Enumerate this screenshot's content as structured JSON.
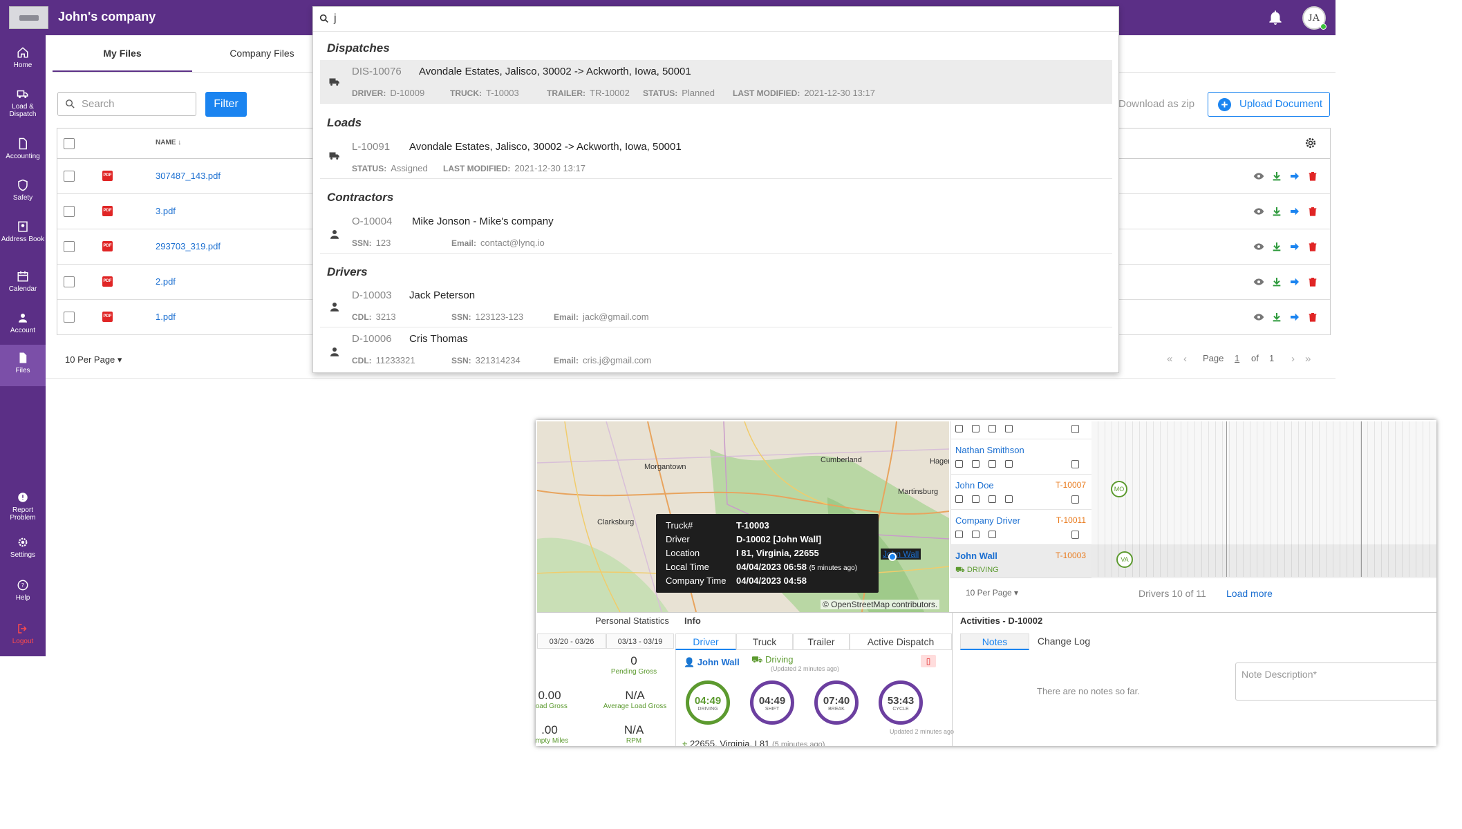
{
  "header": {
    "company": "John's company",
    "avatar_initials": "JA"
  },
  "sidebar": {
    "items": [
      {
        "label": "Home",
        "icon": "home-icon"
      },
      {
        "label": "Load & Dispatch",
        "icon": "truck-icon"
      },
      {
        "label": "Accounting",
        "icon": "document-icon"
      },
      {
        "label": "Safety",
        "icon": "shield-icon"
      },
      {
        "label": "Address Book",
        "icon": "address-book-icon"
      },
      {
        "label": "Calendar",
        "icon": "calendar-icon"
      },
      {
        "label": "Account",
        "icon": "user-icon"
      },
      {
        "label": "Files",
        "icon": "file-icon",
        "active": true
      },
      {
        "label": "Report Problem",
        "icon": "alert-icon"
      },
      {
        "label": "Settings",
        "icon": "gear-icon"
      },
      {
        "label": "Help",
        "icon": "help-icon"
      },
      {
        "label": "Logout",
        "icon": "logout-icon"
      }
    ]
  },
  "tabs": {
    "my_files": "My Files",
    "company_files": "Company Files"
  },
  "toolbar": {
    "search_placeholder": "Search",
    "filter_label": "Filter",
    "zip_label": "Download as zip",
    "upload_label": "Upload Document"
  },
  "table": {
    "name_header": "NAME",
    "sort_glyph": "↓",
    "rows": [
      {
        "name": "307487_143.pdf"
      },
      {
        "name": "3.pdf"
      },
      {
        "name": "293703_319.pdf"
      },
      {
        "name": "2.pdf"
      },
      {
        "name": "1.pdf"
      }
    ],
    "per_page": "10 Per Page",
    "pager": {
      "page_label": "Page",
      "current": "1",
      "of_label": "of",
      "total": "1"
    }
  },
  "search_dropdown": {
    "query": "j",
    "sections": {
      "dispatches": "Dispatches",
      "loads": "Loads",
      "contractors": "Contractors",
      "drivers": "Drivers"
    },
    "dispatch": {
      "id": "DIS-10076",
      "route": "Avondale Estates, Jalisco, 30002 -> Ackworth, Iowa, 50001",
      "driver_label": "DRIVER:",
      "driver": "D-10009",
      "truck_label": "TRUCK:",
      "truck": "T-10003",
      "trailer_label": "TRAILER:",
      "trailer": "TR-10002",
      "status_label": "STATUS:",
      "status": "Planned",
      "modified_label": "LAST MODIFIED:",
      "modified": "2021-12-30 13:17"
    },
    "load": {
      "id": "L-10091",
      "route": "Avondale Estates, Jalisco, 30002 -> Ackworth, Iowa, 50001",
      "status_label": "STATUS:",
      "status": "Assigned",
      "modified_label": "LAST MODIFIED:",
      "modified": "2021-12-30 13:17"
    },
    "contractor": {
      "id": "O-10004",
      "name": "Mike Jonson - Mike's company",
      "ssn_label": "SSN:",
      "ssn": "123",
      "email_label": "Email:",
      "email": "contact@lynq.io"
    },
    "drivers": [
      {
        "id": "D-10003",
        "name": "Jack Peterson",
        "cdl_label": "CDL:",
        "cdl": "3213",
        "ssn_label": "SSN:",
        "ssn": "123123-123",
        "email_label": "Email:",
        "email": "jack@gmail.com"
      },
      {
        "id": "D-10006",
        "name": "Cris Thomas",
        "cdl_label": "CDL:",
        "cdl": "11233321",
        "ssn_label": "SSN:",
        "ssn": "321314234",
        "email_label": "Email:",
        "email": "cris.j@gmail.com"
      }
    ]
  },
  "embed": {
    "map_labels": {
      "morgantown": "Morgantown",
      "cumberland": "Cumberland",
      "hager": "Hager",
      "martinsburg": "Martinsburg",
      "clarksburg": "Clarksburg"
    },
    "tooltip": {
      "truck_k": "Truck#",
      "truck_v": "T-10003",
      "driver_k": "Driver",
      "driver_v": "D-10002 [John Wall]",
      "location_k": "Location",
      "location_v": "I 81, Virginia, 22655",
      "local_k": "Local Time",
      "local_v": "04/04/2023 06:58",
      "local_note": "(5 minutes ago)",
      "company_k": "Company Time",
      "company_v": "04/04/2023 04:58"
    },
    "marker_label": "John Wall",
    "osm": "© OpenStreetMap contributors.",
    "drivers": [
      {
        "name": "",
        "truck": ""
      },
      {
        "name": "Nathan Smithson",
        "truck": ""
      },
      {
        "name": "John Doe",
        "truck": "T-10007"
      },
      {
        "name": "Company Driver",
        "truck": "T-10011"
      },
      {
        "name": "John Wall",
        "truck": "T-10003",
        "status": "DRIVING"
      }
    ],
    "timeline_marks": [
      "MO",
      "VA"
    ],
    "drivers_footer": {
      "per_page": "10 Per Page",
      "count": "Drivers 10 of 11",
      "load_more": "Load more"
    },
    "personal_stats_label": "Personal Statistics",
    "info_label": "Info",
    "weeks": [
      "03/20 - 03/26",
      "03/13 - 03/19"
    ],
    "stats": [
      {
        "val": "0",
        "lbl": "Pending Gross"
      },
      {
        "val": "0.00",
        "lbl": "Load Gross"
      },
      {
        "val": "N/A",
        "lbl": "Average Load Gross"
      },
      {
        "val": ".00",
        "lbl": "Empty Miles"
      },
      {
        "val": "N/A",
        "lbl": "RPM"
      }
    ],
    "info_tabs": [
      "Driver",
      "Truck",
      "Trailer",
      "Active Dispatch"
    ],
    "driver_name": "John Wall",
    "driving_status": "Driving",
    "driving_updated": "(Updated 2 minutes ago)",
    "rings": [
      {
        "time": "04:49",
        "label": "DRIVING",
        "color": "#5c9a2f"
      },
      {
        "time": "04:49",
        "label": "SHIFT",
        "color": "#6c3fa0"
      },
      {
        "time": "07:40",
        "label": "BREAK",
        "color": "#6c3fa0"
      },
      {
        "time": "53:43",
        "label": "CYCLE",
        "color": "#6c3fa0"
      }
    ],
    "rings_updated": "Updated 2 minutes ago",
    "location": "22655, Virginia, I 81",
    "location_ago": "(5 minutes ago)",
    "activities_title": "Activities - D-10002",
    "activity_tabs": [
      "Notes",
      "Change Log"
    ],
    "no_notes": "There are no notes so far.",
    "note_placeholder": "Note Description*"
  }
}
